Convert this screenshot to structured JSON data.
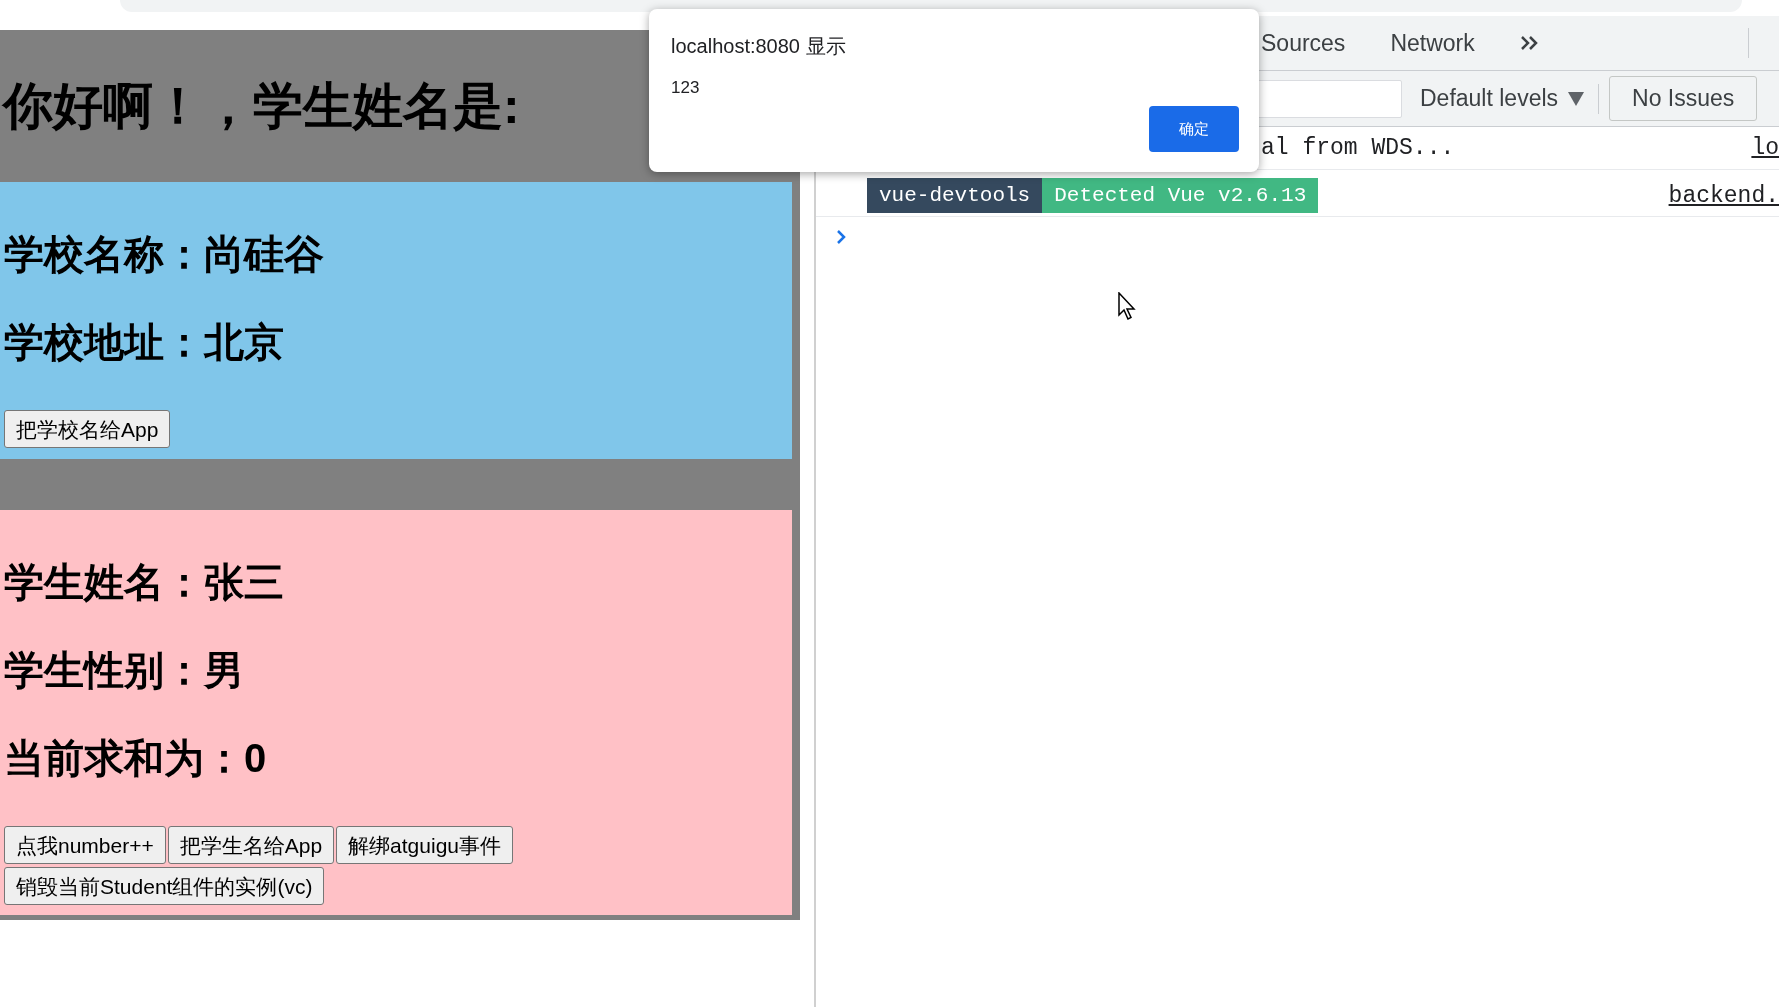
{
  "app": {
    "greeting": "你好啊！，学生姓名是:",
    "school": {
      "lines": [
        "学校名称：尚硅谷",
        "学校地址：北京"
      ],
      "buttons": [
        "把学校名给App"
      ]
    },
    "student": {
      "lines": [
        "学生姓名：张三",
        "学生性别：男",
        "当前求和为：0"
      ],
      "buttons": [
        "点我number++",
        "把学生名给App",
        "解绑atguigu事件",
        "销毁当前Student组件的实例(vc)"
      ]
    }
  },
  "devtools": {
    "tabs": [
      {
        "label": "Sources",
        "selected": false
      },
      {
        "label": "Network",
        "selected": false
      }
    ],
    "levels": "Default levels",
    "issues": "No Issues",
    "console": [
      {
        "kind": "text",
        "text": "al from WDS...",
        "source": "lo"
      },
      {
        "kind": "badges",
        "badges": [
          {
            "text": "vue-devtools",
            "color": "#35495e"
          },
          {
            "text": "Detected Vue v2.6.13",
            "color": "#41b883"
          }
        ],
        "source": "backend."
      }
    ]
  },
  "dialog": {
    "title": "localhost:8080 显示",
    "message": "123",
    "button": "确定"
  }
}
